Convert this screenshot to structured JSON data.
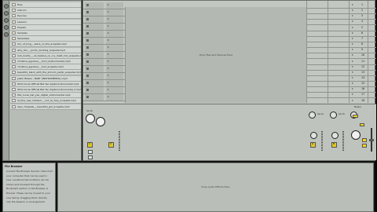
{
  "browser": {
    "items": [
      {
        "label": "Files",
        "type": "folder"
      },
      {
        "label": "Instrum",
        "type": "folder"
      },
      {
        "label": "Devices",
        "type": "folder"
      },
      {
        "label": "Lessons",
        "type": "folder"
      },
      {
        "label": "Presets",
        "type": "folder"
      },
      {
        "label": "Samples",
        "type": "folder"
      },
      {
        "label": "Templates",
        "type": "folder"
      },
      {
        "label": "lion_of_king_-_tears_on_fire_acapella.mp3",
        "type": "file"
      },
      {
        "label": "why_don_-_prodv_working_acapella.mp3",
        "type": "file"
      },
      {
        "label": "lock_buddy_-_ok_believe_ou_cry_dualt_mix_acapella.mp3",
        "type": "file"
      },
      {
        "label": "christina_aguilera_-_hurt_(instrumental).mp3",
        "type": "file"
      },
      {
        "label": "christina_aguilera_-_hurt_acapella.mp3",
        "type": "file"
      },
      {
        "label": "beautiful_black_with_the_shroom_jakob_acapella.mp3",
        "type": "file"
      },
      {
        "label": "Justin Bieber - BABY (INSTRUMENTAL).mp3",
        "type": "file"
      },
      {
        "label": "Whiz Curse Official Bat Yao digital Instrumental.mp3",
        "type": "file"
      },
      {
        "label": "Whiz Curse Official Bat Yao digital instrumental_2.mp3",
        "type": "file"
      },
      {
        "label": "Wiz_curse_bat_yao_digital_instrumental.mp3",
        "type": "file"
      },
      {
        "label": "ad_the_real_maheim_-_not_ok_foxy_acapella.mp3",
        "type": "file"
      },
      {
        "label": "zayn_chapelle_-_beautiful_girl_acapella.mp3",
        "type": "file"
      }
    ]
  },
  "info": {
    "title": "File Browser",
    "lines": [
      "Current File Browser Section: Here from",
      "your computer that can be used in",
      "Live. Locations like locations can be",
      "shown and browsed through the",
      "Bookmark section in the Browser is",
      "this bar. These can be moved to your",
      "Live Set by dragging them directly",
      "into the Session or Arrangement"
    ]
  },
  "session": {
    "drop_label": "Drop Files and Devices Here",
    "scene_numbers": [
      "1",
      "2",
      "3",
      "4",
      "5",
      "6",
      "7",
      "8",
      "9",
      "10",
      "11",
      "12",
      "13",
      "14",
      "15",
      "16",
      "17",
      "18"
    ],
    "master_labels": {
      "sends": "Sends",
      "stop": "Stop Clips"
    },
    "track_slots": 14
  },
  "mixer": {
    "sends_label": "Sends",
    "master_label": "Master",
    "track_numbers": [
      "1",
      "2"
    ],
    "return_letters": [
      "A",
      "B"
    ],
    "solo_label": "S",
    "cue_label": "C",
    "db_readouts": [
      "-inf",
      "-inf"
    ],
    "colors": {
      "speaker_on": "#e2ca1f",
      "highlight": "#f5d21e"
    }
  },
  "detail": {
    "drop_label": "Drop Audio Effects Here"
  }
}
